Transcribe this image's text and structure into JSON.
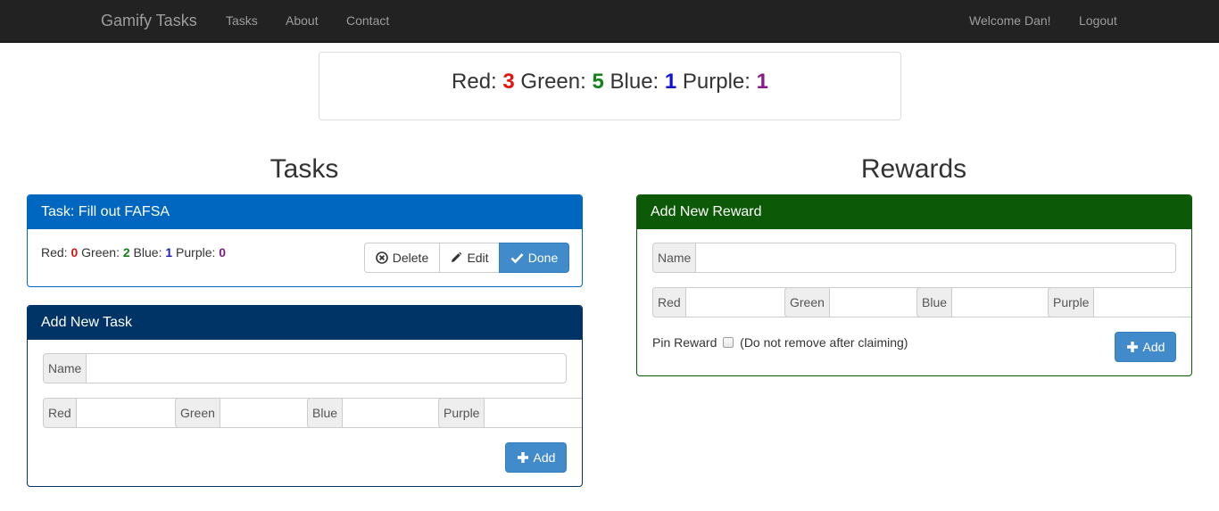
{
  "nav": {
    "brand": "Gamify Tasks",
    "links": [
      "Tasks",
      "About",
      "Contact"
    ],
    "welcome": "Welcome Dan!",
    "logout": "Logout"
  },
  "score": {
    "red_label": "Red:",
    "red": "3",
    "green_label": "Green:",
    "green": "5",
    "blue_label": "Blue:",
    "blue": "1",
    "purple_label": "Purple:",
    "purple": "1"
  },
  "tasks_title": "Tasks",
  "rewards_title": "Rewards",
  "task_card": {
    "heading": "Task: Fill out FAFSA",
    "red_label": "Red:",
    "red": "0",
    "green_label": "Green:",
    "green": "2",
    "blue_label": "Blue:",
    "blue": "1",
    "purple_label": "Purple:",
    "purple": "0",
    "delete_label": "Delete",
    "edit_label": "Edit",
    "done_label": "Done"
  },
  "add_task": {
    "heading": "Add New Task",
    "name_addon": "Name",
    "red_addon": "Red",
    "green_addon": "Green",
    "blue_addon": "Blue",
    "purple_addon": "Purple",
    "add_label": "Add"
  },
  "add_reward": {
    "heading": "Add New Reward",
    "name_addon": "Name",
    "red_addon": "Red",
    "green_addon": "Green",
    "blue_addon": "Blue",
    "purple_addon": "Purple",
    "pin_label": "Pin Reward",
    "pin_note": "(Do not remove after claiming)",
    "add_label": "Add"
  },
  "colors": {
    "navbar": "#222222",
    "task_panel": "#0067c0",
    "add_task_panel": "#003366",
    "reward_panel": "#0c5a08",
    "primary_button": "#428bca"
  },
  "icons": {
    "delete": "times-circle-icon",
    "edit": "pencil-icon",
    "done": "checkmark-icon",
    "add": "plus-icon"
  }
}
